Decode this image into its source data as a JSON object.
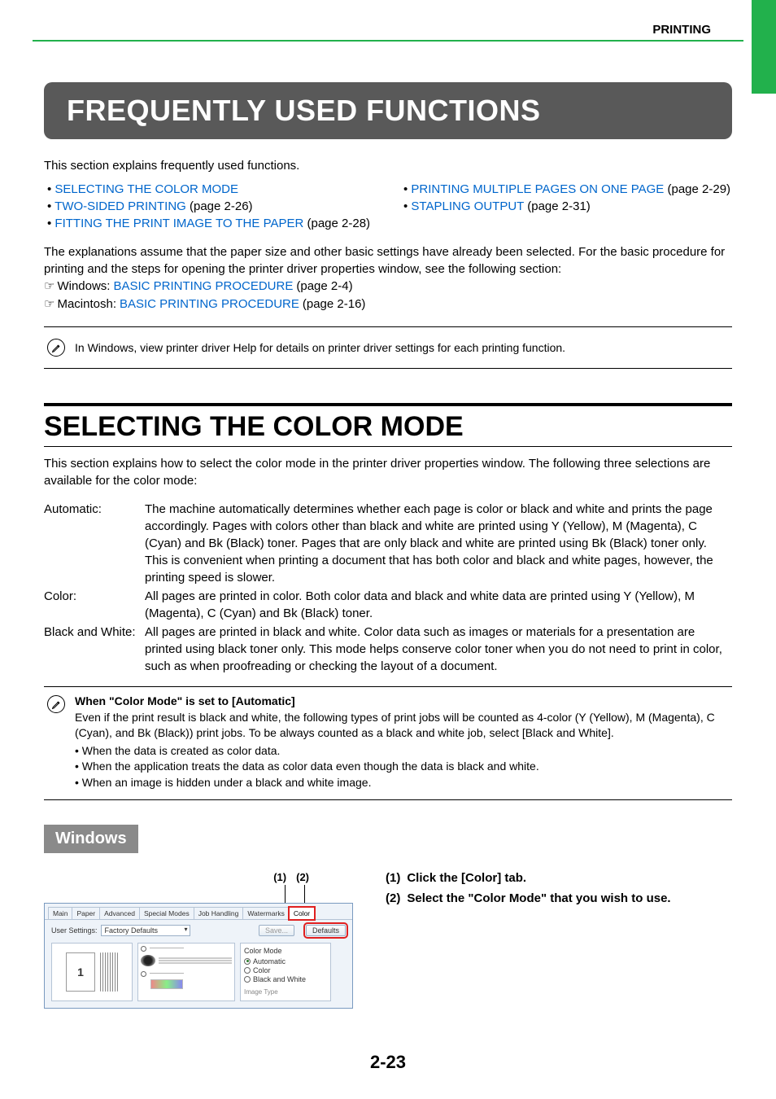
{
  "header": {
    "section": "PRINTING"
  },
  "title": "FREQUENTLY USED FUNCTIONS",
  "intro": "This section explains frequently used functions.",
  "links_left": [
    {
      "text": "SELECTING THE COLOR MODE",
      "suffix": ""
    },
    {
      "text": "TWO-SIDED PRINTING",
      "suffix": " (page 2-26)"
    },
    {
      "text": "FITTING THE PRINT IMAGE TO THE PAPER",
      "suffix": " (page 2-28)"
    }
  ],
  "links_right": [
    {
      "text": "PRINTING MULTIPLE PAGES ON ONE PAGE",
      "suffix": " (page 2-29)"
    },
    {
      "text": "STAPLING OUTPUT",
      "suffix": " (page 2-31)"
    }
  ],
  "assume": {
    "line1": "The explanations assume that the paper size and other basic settings have already been selected. For the basic procedure for printing and the steps for opening the printer driver properties window, see the following section:",
    "win_prefix": "Windows: ",
    "win_link": "BASIC PRINTING PROCEDURE",
    "win_suffix": " (page 2-4)",
    "mac_prefix": "Macintosh: ",
    "mac_link": "BASIC PRINTING PROCEDURE",
    "mac_suffix": " (page 2-16)"
  },
  "note1": "In Windows, view printer driver Help for details on printer driver settings for each printing function.",
  "section2": {
    "title": "SELECTING THE COLOR MODE",
    "intro": "This section explains how to select the color mode in the printer driver properties window. The following three selections are available for the color mode:",
    "defs": [
      {
        "term": "Automatic:",
        "desc": "The machine automatically determines whether each page is color or black and white and prints the page accordingly. Pages with colors other than black and white are printed using Y (Yellow), M (Magenta), C (Cyan) and Bk (Black) toner. Pages that are only black and white are printed using Bk (Black) toner only. This is convenient when printing a document that has both color and black and white pages, however, the printing speed is slower."
      },
      {
        "term": "Color:",
        "desc": "All pages are printed in color. Both color data and black and white data are printed using Y (Yellow), M (Magenta), C (Cyan) and Bk (Black) toner."
      },
      {
        "term": "Black and White:",
        "desc": "All pages are printed in black and white. Color data such as images or materials for a presentation are printed using black toner only. This mode helps conserve color toner when you do not need to print in color, such as when proofreading or checking the layout of a document."
      }
    ]
  },
  "note2": {
    "title": "When \"Color Mode\" is set to [Automatic]",
    "body": "Even if the print result is black and white, the following types of print jobs will be counted as 4-color (Y (Yellow), M (Magenta), C (Cyan), and Bk (Black)) print jobs. To be always counted as a black and white job, select [Black and White].",
    "items": [
      "When the data is created as color data.",
      "When the application treats the data as color data even though the data is black and white.",
      "When an image is hidden under a black and white image."
    ]
  },
  "windows_tag": "Windows",
  "callouts": {
    "c1": "(1)",
    "c2": "(2)"
  },
  "dialog": {
    "tabs": [
      "Main",
      "Paper",
      "Advanced",
      "Special Modes",
      "Job Handling",
      "Watermarks",
      "Color"
    ],
    "user_settings_label": "User Settings:",
    "user_settings_value": "Factory Defaults",
    "save_btn": "Save...",
    "defaults_btn": "Defaults",
    "preview_number": "1",
    "color_mode_title": "Color Mode",
    "radios": [
      "Automatic",
      "Color",
      "Black and White"
    ],
    "image_type_label": "Image Type"
  },
  "steps": {
    "s1": "Click the [Color] tab.",
    "s2": "Select the \"Color Mode\" that you wish to use."
  },
  "page_number": "2-23"
}
